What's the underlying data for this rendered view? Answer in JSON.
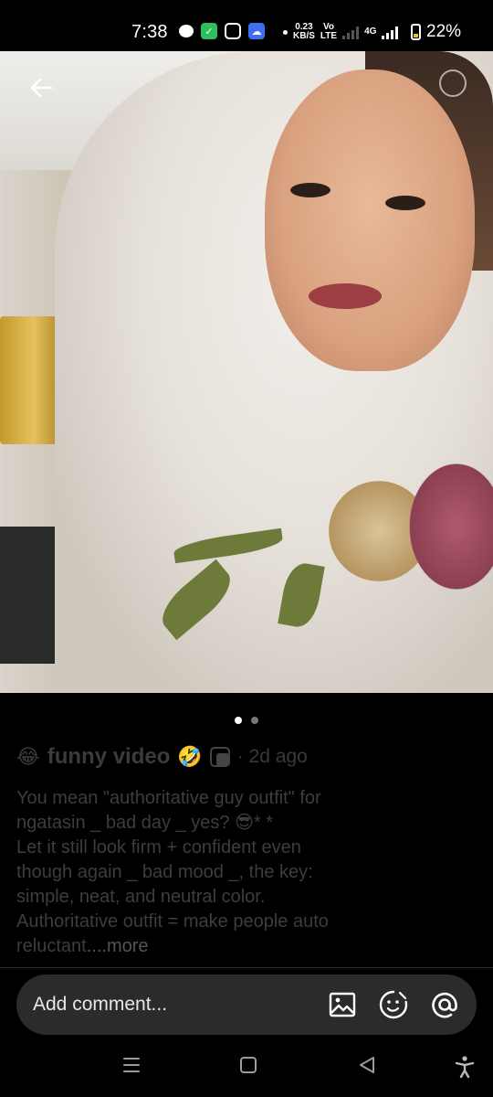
{
  "status_bar": {
    "time": "7:38",
    "net_speed_value": "0.23",
    "net_speed_unit": "KB/S",
    "volte_top": "Vo",
    "volte_bottom": "LTE",
    "network_type": "4G",
    "battery_percent": "22%"
  },
  "photo": {
    "pager_total": 2,
    "pager_active_index": 0
  },
  "post": {
    "title_emoji_left": "😂",
    "title": "funny video",
    "title_emoji_right": "🤣",
    "time_ago": "· 2d ago",
    "body": "You mean \"authoritative guy outfit\" for\nngatasin _ bad day _ yes? 😎* *\nLet it still look firm + confident even\nthough again _ bad mood _, the key:\nsimple, neat, and neutral color.\nAuthoritative outfit = make people auto\nreluctant",
    "more_label": "....more"
  },
  "comment_bar": {
    "placeholder": "Add comment..."
  },
  "icons": {
    "back": "arrow-left-icon",
    "image": "image-icon",
    "sticker": "sticker-icon",
    "mention": "at-icon"
  },
  "colors": {
    "background": "#000000",
    "comment_bar_bg": "#2b2b2b",
    "dim_text": "#3d3d3d"
  }
}
